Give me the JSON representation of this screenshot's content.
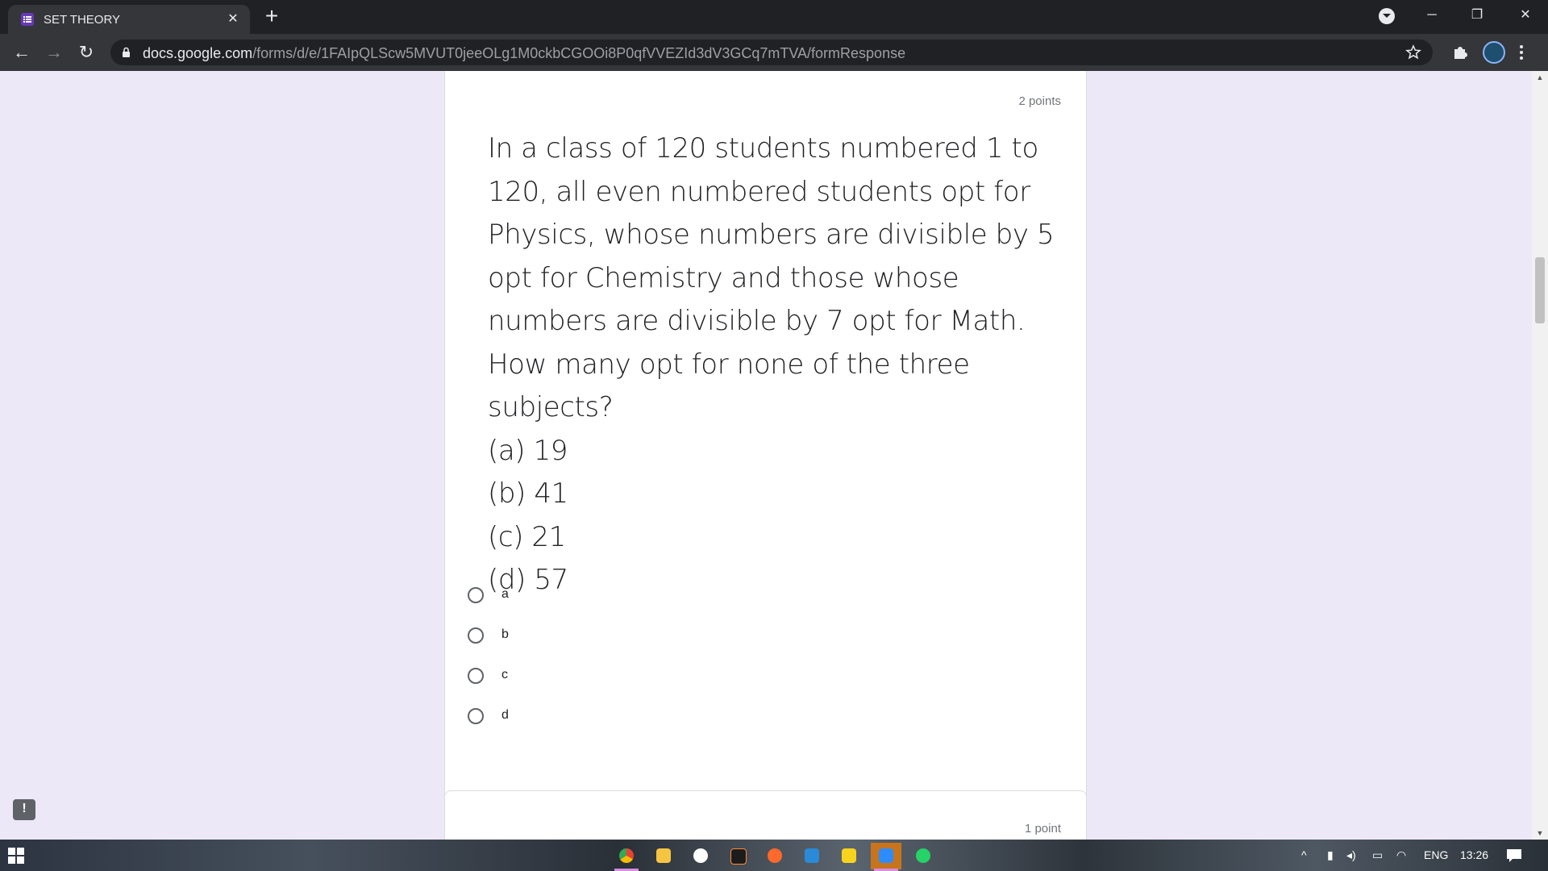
{
  "browser": {
    "tab_title": "SET THEORY",
    "tab_close": "✕",
    "new_tab": "+",
    "window_minimize": "─",
    "window_restore": "❐",
    "window_close": "✕",
    "back": "←",
    "forward": "→",
    "reload": "↻",
    "url_host": "docs.google.com",
    "url_path": "/forms/d/e/1FAIpQLScw5MVUT0jeeOLg1M0ckbCGOOi8P0qfVVEZId3dV3GCq7mTVA/formResponse"
  },
  "question": {
    "points": "2 points",
    "text": "In a class of 120 students numbered 1 to 120, all even numbered students opt for Physics, whose numbers are divisible by 5 opt for Chemistry and those whose numbers are divisible by 7 opt for Math. How many opt for none of the three subjects?",
    "listed_options": [
      "(a) 19",
      "(b) 41",
      "(c) 21",
      "(d) 57"
    ],
    "choices": [
      "a",
      "b",
      "c",
      "d"
    ]
  },
  "next_question": {
    "points": "1 point"
  },
  "feedback_button": "!",
  "taskbar": {
    "apps": [
      "chrome-icon",
      "file-explorer-icon",
      "app-icon",
      "terminal-icon",
      "app-icon",
      "vscode-icon",
      "sticky-notes-icon",
      "zoom-icon",
      "whatsapp-icon"
    ],
    "language": "ENG",
    "time": "13:26"
  },
  "colors": {
    "page_background": "#ede8f8",
    "form_accent": "#673ab7",
    "chrome_dark": "#202124",
    "chrome_toolbar": "#35363a"
  }
}
